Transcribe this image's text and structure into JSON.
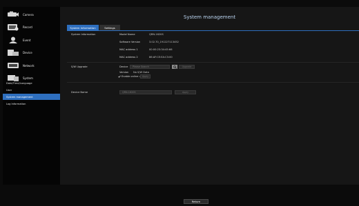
{
  "sidebar": {
    "items": [
      {
        "label": "Camera",
        "icon": "camera-icon"
      },
      {
        "label": "Record",
        "icon": "record-icon"
      },
      {
        "label": "Event",
        "icon": "event-icon"
      },
      {
        "label": "Device",
        "icon": "device-icon"
      },
      {
        "label": "Network",
        "icon": "network-icon"
      },
      {
        "label": "System",
        "icon": "system-icon"
      }
    ],
    "subitems": [
      {
        "label": "Date/Time/Language",
        "active": false
      },
      {
        "label": "User",
        "active": false
      },
      {
        "label": "System management",
        "active": true
      },
      {
        "label": "Log Information",
        "active": false
      }
    ]
  },
  "main": {
    "title": "System management",
    "tabs": [
      {
        "label": "System Information",
        "active": true
      },
      {
        "label": "Settings",
        "active": false
      }
    ],
    "system_info": {
      "section_label": "System Information",
      "rows": [
        {
          "label": "Model Name",
          "value": "QRN-1620S"
        },
        {
          "label": "Software Version",
          "value": "3.02.70_191227113452"
        },
        {
          "label": "MAC address 1",
          "value": "00:00:23:34:45:66"
        },
        {
          "label": "MAC address 2",
          "value": "86:AF:CE:EA:C3:00"
        }
      ]
    },
    "sw_upgrade": {
      "section_label": "S/W Upgrade",
      "device_label": "Device",
      "device_placeholder": "Please Search",
      "upgrade_label": "Upgrade",
      "version_label": "Version",
      "version_value": "No S/W Data",
      "online_upgrade_label": "Enable online upgrade",
      "online_upgrade_checked": true,
      "apply_label": "Apply"
    },
    "device_name": {
      "section_label": "Device Name",
      "value": "QRN-1620S",
      "apply_label": "Apply"
    }
  },
  "footer": {
    "return_label": "Return"
  },
  "colors": {
    "accent": "#2e6fbf",
    "background": "#0b0b0b",
    "panel": "#161616",
    "title": "#bcd6f2"
  }
}
